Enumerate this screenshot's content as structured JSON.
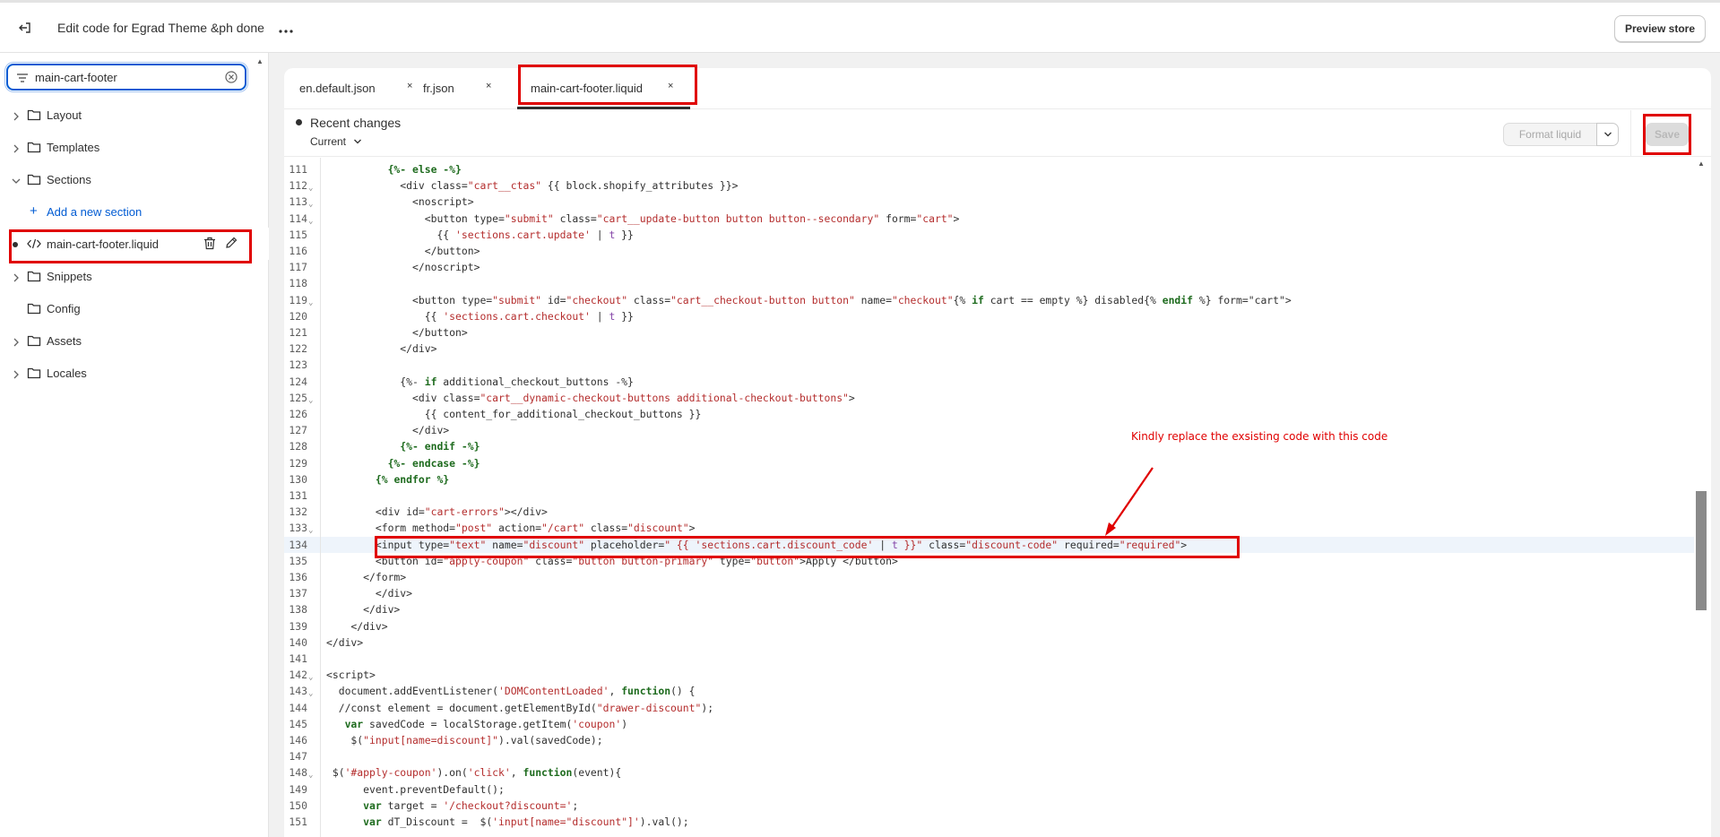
{
  "header": {
    "title": "Edit code for Egrad Theme &ph done",
    "preview_label": "Preview store"
  },
  "sidebar": {
    "search_value": "main-cart-footer",
    "items": [
      {
        "label": "Layout"
      },
      {
        "label": "Templates"
      },
      {
        "label": "Sections"
      },
      {
        "label": "Add a new section"
      },
      {
        "label": "main-cart-footer.liquid"
      },
      {
        "label": "Snippets"
      },
      {
        "label": "Config"
      },
      {
        "label": "Assets"
      },
      {
        "label": "Locales"
      }
    ]
  },
  "tabs": [
    {
      "label": "en.default.json",
      "close": "×"
    },
    {
      "label": "fr.json",
      "close": "×"
    },
    {
      "label": "main-cart-footer.liquid",
      "close": "×"
    }
  ],
  "toolbar": {
    "recent_changes": "Recent changes",
    "current": "Current",
    "format_label": "Format liquid",
    "save_label": "Save"
  },
  "annotation": "Kindly replace the exsisting code with this code",
  "code_lines": [
    {
      "n": "111",
      "fold": false,
      "html": "          <span class=\"lk\">{%- else -%}</span>"
    },
    {
      "n": "112",
      "fold": true,
      "html": "            <span class=\"tg\">&lt;div</span> class=<span class=\"st\">\"cart__ctas\"</span> {{ block.shopify_attributes }}&gt;"
    },
    {
      "n": "113",
      "fold": true,
      "html": "              &lt;noscript&gt;"
    },
    {
      "n": "114",
      "fold": true,
      "html": "                &lt;button type=<span class=\"st\">\"submit\"</span> class=<span class=\"st\">\"cart__update-button button button--secondary\"</span> form=<span class=\"st\">\"cart\"</span>&gt;"
    },
    {
      "n": "115",
      "fold": false,
      "html": "                  {{ <span class=\"st\">'sections.cart.update'</span> | <span class=\"filt\">t</span> }}"
    },
    {
      "n": "116",
      "fold": false,
      "html": "                &lt;/button&gt;"
    },
    {
      "n": "117",
      "fold": false,
      "html": "              &lt;/noscript&gt;"
    },
    {
      "n": "118",
      "fold": false,
      "html": ""
    },
    {
      "n": "119",
      "fold": true,
      "html": "              &lt;button type=<span class=\"st\">\"submit\"</span> id=<span class=\"st\">\"checkout\"</span> class=<span class=\"st\">\"cart__checkout-button button\"</span> name=<span class=\"st\">\"checkout\"</span>{% <span class=\"lk\">if</span> cart == empty %} disabled{% <span class=\"lk\">endif</span> %} form=\"cart\"&gt;"
    },
    {
      "n": "120",
      "fold": false,
      "html": "                {{ <span class=\"st\">'sections.cart.checkout'</span> | <span class=\"filt\">t</span> }}"
    },
    {
      "n": "121",
      "fold": false,
      "html": "              &lt;/button&gt;"
    },
    {
      "n": "122",
      "fold": false,
      "html": "            &lt;/div&gt;"
    },
    {
      "n": "123",
      "fold": false,
      "html": ""
    },
    {
      "n": "124",
      "fold": false,
      "html": "            {%- <span class=\"lk\">if</span> additional_checkout_buttons -%}"
    },
    {
      "n": "125",
      "fold": true,
      "html": "              &lt;div class=<span class=\"st\">\"cart__dynamic-checkout-buttons additional-checkout-buttons\"</span>&gt;"
    },
    {
      "n": "126",
      "fold": false,
      "html": "                {{ content_for_additional_checkout_buttons }}"
    },
    {
      "n": "127",
      "fold": false,
      "html": "              &lt;/div&gt;"
    },
    {
      "n": "128",
      "fold": false,
      "html": "            <span class=\"lk\">{%- endif -%}</span>"
    },
    {
      "n": "129",
      "fold": false,
      "html": "          <span class=\"lk\">{%- endcase -%}</span>"
    },
    {
      "n": "130",
      "fold": false,
      "html": "        <span class=\"lk\">{% endfor %}</span>"
    },
    {
      "n": "131",
      "fold": false,
      "html": ""
    },
    {
      "n": "132",
      "fold": false,
      "html": "        &lt;div id=<span class=\"st\">\"cart-errors\"</span>&gt;&lt;/div&gt;"
    },
    {
      "n": "133",
      "fold": true,
      "html": "        &lt;form method=<span class=\"st\">\"post\"</span> action=<span class=\"st\">\"/cart\"</span> class=<span class=\"st\">\"discount\"</span>&gt;"
    },
    {
      "n": "134",
      "fold": false,
      "html": "        &lt;input type=<span class=\"st\">\"text\"</span> name=<span class=\"st\">\"discount\"</span> placeholder=<span class=\"st\">\" {{ 'sections.cart.discount_code' </span>| <span class=\"filt\">t</span> <span class=\"st\">}}\"</span> class=<span class=\"st\">\"discount-code\"</span> required=<span class=\"st\">\"required\"</span>&gt;"
    },
    {
      "n": "135",
      "fold": false,
      "html": "        &lt;button id=<span class=\"st\">\"apply-coupon\"</span> class=<span class=\"st\">\"button button-primary\"</span> type=<span class=\"st\">\"button\"</span>&gt;Apply &lt;/button&gt;"
    },
    {
      "n": "136",
      "fold": false,
      "html": "      &lt;/form&gt;"
    },
    {
      "n": "137",
      "fold": false,
      "html": "        &lt;/div&gt;"
    },
    {
      "n": "138",
      "fold": false,
      "html": "      &lt;/div&gt;"
    },
    {
      "n": "139",
      "fold": false,
      "html": "    &lt;/div&gt;"
    },
    {
      "n": "140",
      "fold": false,
      "html": "&lt;/div&gt;"
    },
    {
      "n": "141",
      "fold": false,
      "html": ""
    },
    {
      "n": "142",
      "fold": true,
      "html": "&lt;script&gt;"
    },
    {
      "n": "143",
      "fold": true,
      "html": "  document.addEventListener(<span class=\"st\">'DOMContentLoaded'</span>, <span class=\"lk\">function</span>() {"
    },
    {
      "n": "144",
      "fold": false,
      "html": "  //const element = document.getElementById(<span class=\"st\">\"drawer-discount\"</span>);"
    },
    {
      "n": "145",
      "fold": false,
      "html": "   <span class=\"lk\">var</span> savedCode = localStorage.getItem(<span class=\"st\">'coupon'</span>)"
    },
    {
      "n": "146",
      "fold": false,
      "html": "    $(<span class=\"st\">\"input[name=discount]\"</span>).val(savedCode);"
    },
    {
      "n": "147",
      "fold": false,
      "html": ""
    },
    {
      "n": "148",
      "fold": true,
      "html": " $(<span class=\"st\">'#apply-coupon'</span>).on(<span class=\"st\">'click'</span>, <span class=\"lk\">function</span>(event){"
    },
    {
      "n": "149",
      "fold": false,
      "html": "      event.preventDefault();"
    },
    {
      "n": "150",
      "fold": false,
      "html": "      <span class=\"lk\">var</span> target = <span class=\"st\">'/checkout?discount='</span>;"
    },
    {
      "n": "151",
      "fold": false,
      "html": "      <span class=\"lk\">var</span> dT_Discount =  $(<span class=\"st\">'input[name=\"discount\"]'</span>).val();"
    }
  ]
}
